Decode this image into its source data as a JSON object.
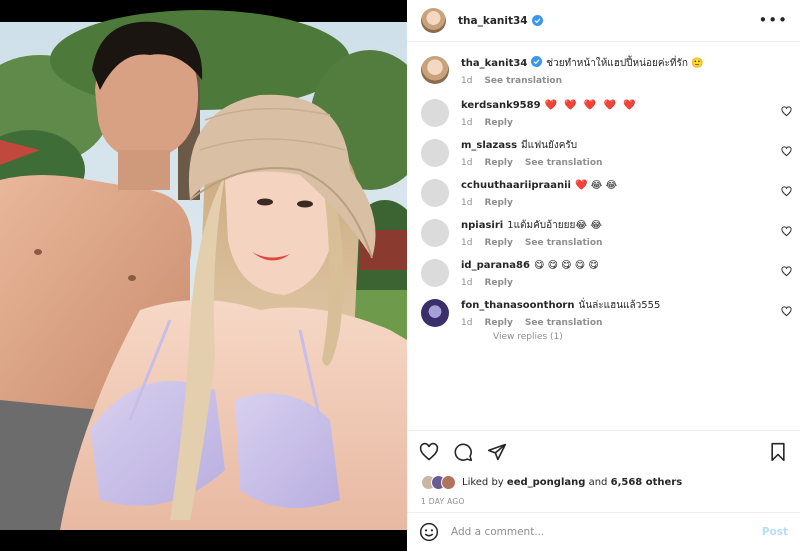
{
  "post": {
    "username": "tha_kanit34",
    "more_icon": "more-horizontal-icon"
  },
  "caption": {
    "username": "tha_kanit34",
    "text": "ช่วยทำหน้าให้แฮปปี้หน่อยค่ะที่รัก 🙂",
    "time": "1d",
    "see_translation": "See translation"
  },
  "comments": [
    {
      "username": "kerdsank9589",
      "text": "❤️ ❤️ ❤️ ❤️ ❤️",
      "time": "1d",
      "reply": "Reply",
      "see_translation": ""
    },
    {
      "username": "m_slazass",
      "text": "มีแฟนยังครับ",
      "time": "1d",
      "reply": "Reply",
      "see_translation": "See translation"
    },
    {
      "username": "cchuuthaariipraanii",
      "text": "❤️ 😂 😂",
      "time": "1d",
      "reply": "Reply",
      "see_translation": ""
    },
    {
      "username": "npiasiri",
      "text": "1แต้มคับอ้ายยย😂 😂",
      "time": "1d",
      "reply": "Reply",
      "see_translation": "See translation"
    },
    {
      "username": "id_parana86",
      "text": "😋 😋 😋 😋 😋",
      "time": "1d",
      "reply": "Reply",
      "see_translation": ""
    },
    {
      "username": "fon_thanasoonthorn",
      "text": "นั่นล่ะแฮนแล้ว555",
      "time": "1d",
      "reply": "Reply",
      "see_translation": "See translation"
    }
  ],
  "view_replies": "View replies (1)",
  "likes": {
    "prefix": "Liked by",
    "user": "eed_ponglang",
    "and": "and",
    "others": "6,568 others"
  },
  "date": "1 DAY AGO",
  "add_comment": {
    "placeholder": "Add a comment...",
    "post_label": "Post"
  },
  "colors": {
    "verified": "#3897f0",
    "post_disabled": "#b2dffc",
    "secondary_text": "#8e8e8e"
  }
}
